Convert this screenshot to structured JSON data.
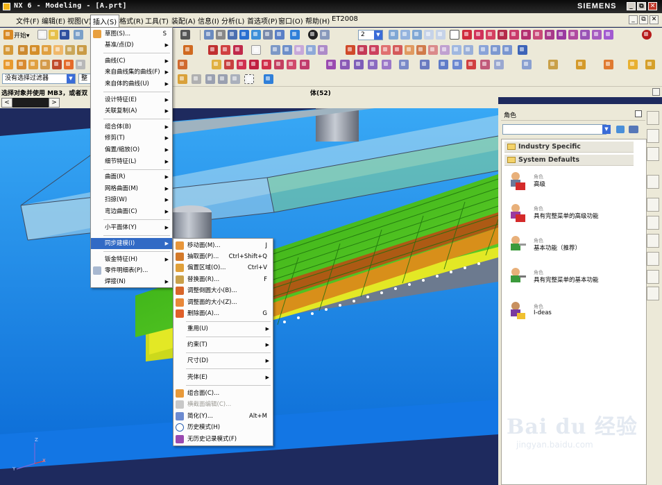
{
  "window": {
    "title": "NX 6 - Modeling - [A.prt]",
    "brand": "SIEMENS",
    "minimize": "_",
    "restore": "⧉",
    "close": "✕"
  },
  "menubar": [
    "文件(F)",
    "编辑(E)",
    "视图(V)",
    "插入(S)",
    "格式(R)",
    "工具(T)",
    "装配(A)",
    "信息(I)",
    "分析(L)",
    "首选项(P)",
    "窗口(O)",
    "帮助(H)",
    "ET2008"
  ],
  "toolbar": {
    "start_label": "开始▾",
    "layer_value": "2",
    "selection_filter": "没有选择过滤器",
    "assembly_filter": "整个"
  },
  "cue_line": {
    "prompt": "选择对象并使用 MB3，或者双",
    "status": "体(52)"
  },
  "tab_nav": {
    "prev": "<",
    "next": ">"
  },
  "insert_menu": {
    "items": [
      {
        "label": "草图(S)...",
        "accel": "S",
        "sub": false
      },
      {
        "label": "基准/点(D)",
        "accel": "",
        "sub": true
      },
      {
        "label": "曲线(C)",
        "accel": "",
        "sub": true
      },
      {
        "label": "来自曲线集的曲线(F)",
        "accel": "",
        "sub": true
      },
      {
        "label": "来自体的曲线(U)",
        "accel": "",
        "sub": true
      },
      {
        "label": "设计特征(E)",
        "accel": "",
        "sub": true
      },
      {
        "label": "关联复制(A)",
        "accel": "",
        "sub": true
      },
      {
        "label": "组合体(B)",
        "accel": "",
        "sub": true
      },
      {
        "label": "修剪(T)",
        "accel": "",
        "sub": true
      },
      {
        "label": "偏置/缩放(O)",
        "accel": "",
        "sub": true
      },
      {
        "label": "细节特征(L)",
        "accel": "",
        "sub": true
      },
      {
        "label": "曲面(R)",
        "accel": "",
        "sub": true
      },
      {
        "label": "网格曲面(M)",
        "accel": "",
        "sub": true
      },
      {
        "label": "扫掠(W)",
        "accel": "",
        "sub": true
      },
      {
        "label": "弯边曲面(C)",
        "accel": "",
        "sub": true
      },
      {
        "label": "小平面体(Y)",
        "accel": "",
        "sub": true
      },
      {
        "label": "同步建模(I)",
        "accel": "",
        "sub": true
      },
      {
        "label": "钣金特征(H)",
        "accel": "",
        "sub": true
      },
      {
        "label": "零件明细表(P)...",
        "accel": "",
        "sub": false
      },
      {
        "label": "焊接(N)",
        "accel": "",
        "sub": true
      }
    ]
  },
  "sync_menu": {
    "items": [
      {
        "label": "移动面(M)...",
        "accel": "J",
        "sub": false,
        "disabled": false
      },
      {
        "label": "抽取面(P)...",
        "accel": "Ctrl+Shift+Q",
        "sub": false,
        "disabled": false
      },
      {
        "label": "偏置区域(O)...",
        "accel": "Ctrl+V",
        "sub": false,
        "disabled": false
      },
      {
        "label": "替换面(R)...",
        "accel": "F",
        "sub": false,
        "disabled": false
      },
      {
        "label": "调整倒圆大小(B)...",
        "accel": "",
        "sub": false,
        "disabled": false
      },
      {
        "label": "调整面的大小(Z)...",
        "accel": "",
        "sub": false,
        "disabled": false
      },
      {
        "label": "删除面(A)...",
        "accel": "G",
        "sub": false,
        "disabled": false
      },
      {
        "label": "重用(U)",
        "accel": "",
        "sub": true,
        "disabled": false
      },
      {
        "label": "约束(T)",
        "accel": "",
        "sub": true,
        "disabled": false
      },
      {
        "label": "尺寸(D)",
        "accel": "",
        "sub": true,
        "disabled": false
      },
      {
        "label": "壳体(E)",
        "accel": "",
        "sub": true,
        "disabled": false
      },
      {
        "label": "组合面(C)...",
        "accel": "",
        "sub": false,
        "disabled": false
      },
      {
        "label": "横截面编辑(C)...",
        "accel": "",
        "sub": false,
        "disabled": true
      },
      {
        "label": "简化(Y)...",
        "accel": "Alt+M",
        "sub": false,
        "disabled": false
      },
      {
        "label": "历史模式(H)",
        "accel": "",
        "sub": false,
        "disabled": false
      },
      {
        "label": "无历史记录模式(F)",
        "accel": "",
        "sub": false,
        "disabled": false
      }
    ]
  },
  "roles_panel": {
    "title": "角色",
    "groups": [
      "Industry Specific",
      "System Defaults"
    ],
    "roles": [
      {
        "category": "角色",
        "name": "高级"
      },
      {
        "category": "角色",
        "name": "具有完整菜单的高级功能"
      },
      {
        "category": "角色",
        "name": "基本功能（推荐）"
      },
      {
        "category": "角色",
        "name": "具有完整菜单的基本功能"
      },
      {
        "category": "角色",
        "name": "I-deas"
      }
    ]
  },
  "triad": {
    "x": "X",
    "y": "Y",
    "z": "Z"
  },
  "watermark": {
    "main": "Bai du 经验",
    "sub": "jingyan.baidu.com"
  },
  "colors": {
    "menu_highlight": "#316ac5",
    "viewport_bg": "#1e2a5e",
    "part_blue": "#0f8ef0",
    "part_green": "#4cc21c",
    "ui_face": "#ece9d8"
  }
}
